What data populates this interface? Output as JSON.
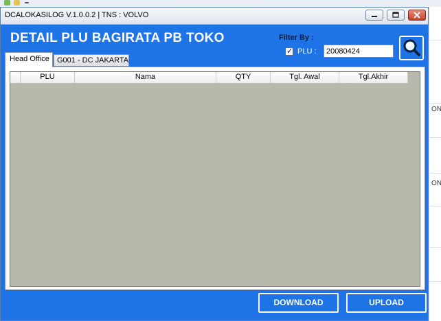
{
  "window": {
    "title": "DCALOKASILOG V.1.0.0.2 | TNS : VOLVO"
  },
  "header": {
    "title": "DETAIL PLU BAGIRATA PB TOKO"
  },
  "filter": {
    "label": "Filter By :",
    "plu_checked": true,
    "plu_check_glyph": "✓",
    "plu_label": "PLU :",
    "plu_value": "20080424"
  },
  "tabs": [
    {
      "label": "Head Office",
      "active": true
    },
    {
      "label": "G001 - DC JAKARTA",
      "active": false
    }
  ],
  "grid": {
    "columns": [
      "PLU",
      "Nama",
      "QTY",
      "Tgl. Awal",
      "Tgl.Akhir"
    ],
    "rows": []
  },
  "buttons": {
    "download": "DOWNLOAD",
    "upload": "UPLOAD"
  },
  "background_app": {
    "visible_cell_texts": [
      "ON",
      "ON"
    ]
  },
  "icons": {
    "search": "magnifier-icon",
    "minimize": "minimize-icon",
    "maximize": "maximize-icon",
    "close": "close-icon"
  },
  "colors": {
    "window_bg": "#1e74e6",
    "grid_bg": "#b9b8ac"
  }
}
